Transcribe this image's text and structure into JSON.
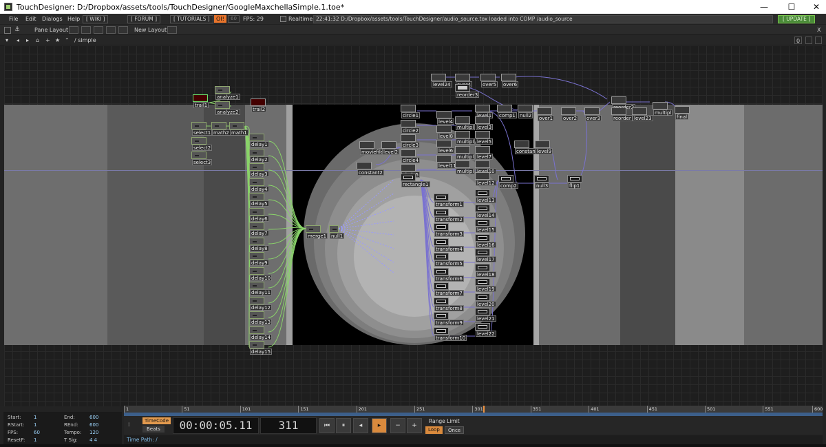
{
  "window": {
    "title": "TouchDesigner: D:/Dropbox/assets/tools/TouchDesigner/GoogleMaxchellaSimple.1.toe*",
    "minimize": "—",
    "maximize": "☐",
    "close": "✕"
  },
  "menu": {
    "items": [
      "File",
      "Edit",
      "Dialogs",
      "Help"
    ],
    "wiki": "[ WIKI ]",
    "forum": "[ FORUM ]",
    "tutorials": "[ TUTORIALS ]",
    "oi": "OI!",
    "sixty": "60",
    "fps": "FPS:  29",
    "realtime": "Realtime",
    "status": "22:41:32 D:/Dropbox/assets/tools/TouchDesigner/audio_source.tox loaded into COMP /audio_source",
    "update": "[ UPDATE ]"
  },
  "panebar": {
    "pane_layout": "Pane Layout",
    "new_layout": "New Layout",
    "close": "X"
  },
  "pathbar": {
    "path": "/ simple",
    "zero": "0"
  },
  "nodes": {
    "trail1": "trail1",
    "analyze1": "analyze1",
    "analyze2": "analyze2",
    "trail2": "trail2",
    "select1": "select1",
    "math2": "math2",
    "math1": "math1",
    "select2": "select2",
    "select3": "select3",
    "delays": [
      "delay1",
      "delay2",
      "delay3",
      "delay4",
      "delay5",
      "delay6",
      "delay7",
      "delay8",
      "delay9",
      "delay10",
      "delay11",
      "delay12",
      "delay13",
      "delay14",
      "delay15"
    ],
    "merge1": "merge1",
    "null1": "null1",
    "moviefilein": "moviefilein",
    "level25": "level2",
    "constant2": "constant2",
    "circles": [
      "circle1",
      "circle2",
      "circle3",
      "circle4",
      "circle5"
    ],
    "rectangle1": "rectangle1",
    "transforms": [
      "transform1",
      "transform2",
      "transform3",
      "transform4",
      "transform5",
      "transform6",
      "transform7",
      "transform8",
      "transform9",
      "transform10"
    ],
    "levelsB": [
      "level13",
      "level14",
      "level15",
      "level16",
      "level17",
      "level18",
      "level19",
      "level20",
      "level21",
      "level22"
    ],
    "level24": "level24",
    "over4": "over4",
    "over5": "over5",
    "over6": "over6",
    "reorder3": "reorder3",
    "level1": "level1",
    "comp1": "comp1",
    "null2": "null2",
    "level4": "level4",
    "multiply1": "multipl",
    "level3": "level3",
    "level8": "level8",
    "multiply2": "multipl",
    "level5": "level5",
    "level6": "level6",
    "multiply3": "multipl",
    "level7": "level7",
    "level11": "level11",
    "multiply4": "multipl",
    "level10": "level10",
    "level12": "level12",
    "comp2": "comp2",
    "null3": "null3",
    "flip1": "flip1",
    "constant": "constan",
    "level9": "level9",
    "over1": "over1",
    "over2": "over2",
    "over3": "over3",
    "reorder2": "reorder2",
    "reorder": "reorder",
    "level23": "level23",
    "multiply5": "multipl",
    "final": "final"
  },
  "timeline": {
    "ruler": [
      "1",
      "51",
      "101",
      "151",
      "201",
      "251",
      "301",
      "351",
      "401",
      "451",
      "501",
      "551",
      "600"
    ],
    "info": {
      "start_l": "Start:",
      "start_v": "1",
      "end_l": "End:",
      "end_v": "600",
      "rstart_l": "RStart:",
      "rstart_v": "1",
      "rend_l": "REnd:",
      "rend_v": "600",
      "fps_l": "FPS:",
      "fps_v": "60",
      "tempo_l": "Tempo:",
      "tempo_v": "120",
      "resetf_l": "ResetF:",
      "resetf_v": "1",
      "tsig_l": "T Sig:",
      "tsig_v": "4    4"
    },
    "timecode_btn": "TimeCode",
    "beats_btn": "Beats",
    "timecode": "00:00:05.11",
    "frame": "311",
    "range_limit": "Range Limit",
    "loop": "Loop",
    "once": "Once",
    "time_path": "Time Path: /"
  }
}
